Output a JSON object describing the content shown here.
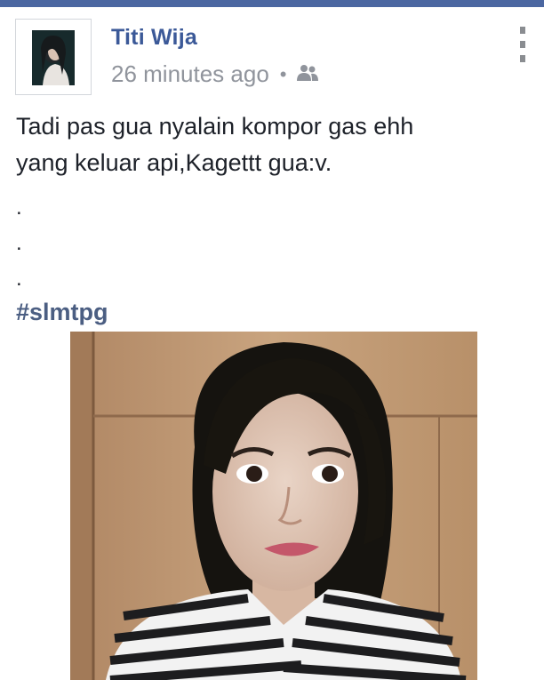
{
  "post": {
    "author": "Titi Wija",
    "timestamp": "26 minutes ago",
    "separator": "•",
    "privacy_icon": "friends-icon",
    "text_line1": "Tadi pas gua nyalain kompor gas ehh",
    "text_line2": "yang keluar api,Kagettt gua:v.",
    "dot1": ".",
    "dot2": ".",
    "dot3": ".",
    "hashtag": "#slmtpg",
    "menu_icon": "more-vertical-icon"
  },
  "colors": {
    "top_bar": "#4b67a1",
    "author": "#3b5998",
    "meta": "#90949c",
    "hashtag": "#4b5e82",
    "text": "#1d2129"
  }
}
